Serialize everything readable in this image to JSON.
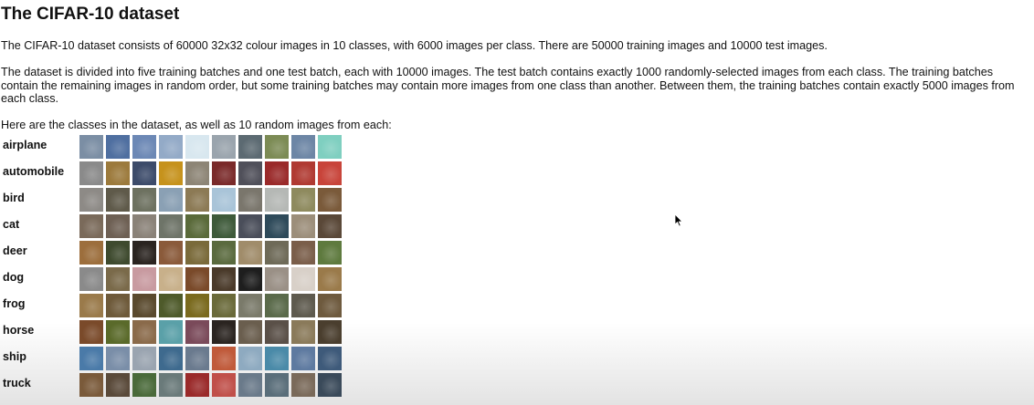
{
  "title": "The CIFAR-10 dataset",
  "paragraphs": {
    "intro": "The CIFAR-10 dataset consists of 60000 32x32 colour images in 10 classes, with 6000 images per class. There are 50000 training images and 10000 test images.",
    "batches_line1": "The dataset is divided into five training batches and one test batch, each with 10000 images. The test batch contains exactly 1000 randomly-selected images from each class. The training batches",
    "batches_line2": "contain the remaining images in random order, but some training batches may contain more images from one class than another. Between them, the training batches contain exactly 5000 images from",
    "batches_line3": "each class.",
    "classes_intro": "Here are the classes in the dataset, as well as 10 random images from each:"
  },
  "classes": [
    {
      "label": "airplane",
      "thumb_colors": [
        "#7b8ea4",
        "#4f6fa0",
        "#6c88b5",
        "#93aac7",
        "#d8e7ef",
        "#9aa4ad",
        "#5c6a72",
        "#7c8b55",
        "#6d86a5",
        "#7fcfc0"
      ]
    },
    {
      "label": "automobile",
      "thumb_colors": [
        "#8a8a8a",
        "#9c7a3c",
        "#3c4b6a",
        "#c6921c",
        "#8d8576",
        "#7a2a2a",
        "#50505a",
        "#9a2a2a",
        "#b03a32",
        "#c8443a"
      ]
    },
    {
      "label": "bird",
      "thumb_colors": [
        "#8d8a86",
        "#5f5a4a",
        "#6d7160",
        "#8aa0b4",
        "#8c7a55",
        "#a9c4d8",
        "#7a766c",
        "#b5b8b5",
        "#8e8a5e",
        "#7a5a3a"
      ]
    },
    {
      "label": "cat",
      "thumb_colors": [
        "#7a6a5a",
        "#6e6054",
        "#8a8278",
        "#6e7468",
        "#5a6a3a",
        "#3e5a3a",
        "#4a4e5a",
        "#2e4a5a",
        "#9c8e7a",
        "#5a4838"
      ]
    },
    {
      "label": "deer",
      "thumb_colors": [
        "#9c6e3c",
        "#3e4a2e",
        "#2a2420",
        "#8a5a3a",
        "#7a6a3a",
        "#5a6a3e",
        "#a08c6a",
        "#6e6a58",
        "#7a5e4a",
        "#5e7a3e"
      ]
    },
    {
      "label": "dog",
      "thumb_colors": [
        "#8a8a8a",
        "#7a6a4a",
        "#c89aa0",
        "#c8b08a",
        "#7a4a2a",
        "#4a3a2a",
        "#1e1e1e",
        "#9a9086",
        "#d8d0c8",
        "#9a7a4a"
      ]
    },
    {
      "label": "frog",
      "thumb_colors": [
        "#9a7a4a",
        "#6e5a3a",
        "#5a4a2e",
        "#4e5a2a",
        "#7a6a1e",
        "#6a6a3a",
        "#7a7a6a",
        "#5a6a4a",
        "#5e5a4e",
        "#6e5a3e"
      ]
    },
    {
      "label": "horse",
      "thumb_colors": [
        "#7a4a2a",
        "#5a6a2a",
        "#8a6a4a",
        "#5aa0a8",
        "#7a4a5a",
        "#2a2420",
        "#6a5e4e",
        "#5a5048",
        "#8a7a5a",
        "#4a3e2e"
      ]
    },
    {
      "label": "ship",
      "thumb_colors": [
        "#4a7aa8",
        "#7a8ea8",
        "#9aa4b0",
        "#3e6a8e",
        "#6a7a8e",
        "#c05a3a",
        "#8eaac0",
        "#4a8aa8",
        "#5e7aa0",
        "#3e5a7a"
      ]
    },
    {
      "label": "truck",
      "thumb_colors": [
        "#7a5a3a",
        "#5a4a3a",
        "#4a6a3a",
        "#6a7a7a",
        "#9a2a2a",
        "#c0504a",
        "#6a7a8a",
        "#5a6e7a",
        "#7a6a5a",
        "#3a4a5a"
      ]
    }
  ]
}
